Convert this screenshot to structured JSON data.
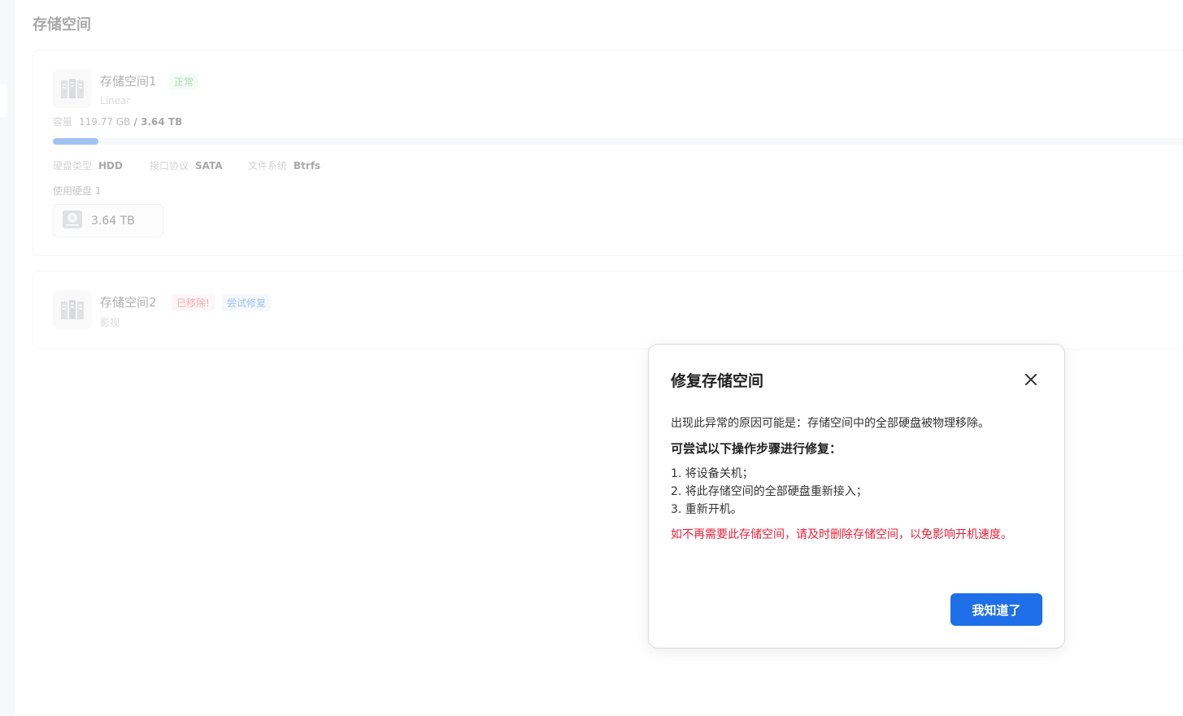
{
  "page": {
    "title": "存储空间"
  },
  "volumes": [
    {
      "name": "存储空间1",
      "status": "正常",
      "raid": "Linear",
      "capacity_label": "容量",
      "used": "119.77 GB",
      "separator": " / ",
      "total": "3.64 TB",
      "used_fraction": 0.032,
      "specs": [
        {
          "label": "硬盘类型",
          "value": "HDD"
        },
        {
          "label": "接口协议",
          "value": "SATA"
        },
        {
          "label": "文件系统",
          "value": "Btrfs"
        }
      ],
      "disks_label": "使用硬盘 1",
      "disk_size": "3.64 TB"
    },
    {
      "name": "存储空间2",
      "status": "已移除!",
      "repair_link": "尝试修复",
      "sub": "影视"
    }
  ],
  "modal": {
    "title": "修复存储空间",
    "reason": "出现此异常的原因可能是：存储空间中的全部硬盘被物理移除。",
    "steps_title": "可尝试以下操作步骤进行修复：",
    "steps": [
      "1. 将设备关机；",
      "2. 将此存储空间的全部硬盘重新接入；",
      "3. 重新开机。"
    ],
    "warning": "如不再需要此存储空间，请及时删除存储空间，以免影响开机速度。",
    "ok_label": "我知道了"
  },
  "colors": {
    "accent": "#1e6fe8",
    "ok": "#2fb344",
    "danger": "#e8323c",
    "warning_text": "#e8213a"
  },
  "icons": {
    "volume": "server-rack-icon",
    "disk": "hard-disk-icon",
    "close": "close-icon"
  }
}
